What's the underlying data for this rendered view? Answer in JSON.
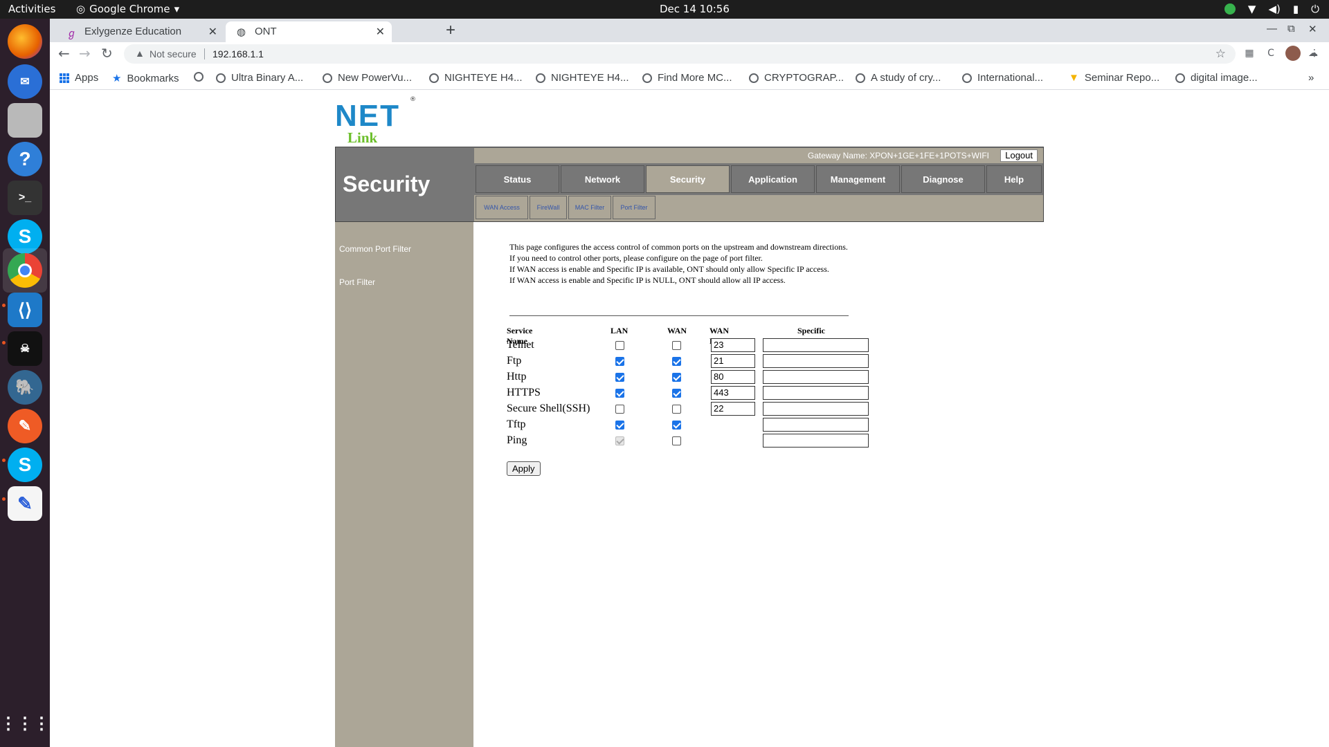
{
  "system_bar": {
    "activities": "Activities",
    "app_name": "Google Chrome",
    "clock": "Dec 14  10:56"
  },
  "browser": {
    "tabs": [
      {
        "title": "Exlygenze Education",
        "active": false
      },
      {
        "title": "ONT",
        "active": true
      }
    ],
    "omnibox": {
      "security": "Not secure",
      "url": "192.168.1.1"
    },
    "bookmarks": [
      "Apps",
      "Bookmarks",
      "Ultra Binary A...",
      "New PowerVu...",
      "NIGHTEYE H4...",
      "NIGHTEYE H4...",
      "Find More MC...",
      "CRYPTOGRAP...",
      "A study of cry...",
      "International...",
      "Seminar Repo...",
      "digital image..."
    ]
  },
  "ont": {
    "logo": {
      "top": "NET",
      "bottom": "Link"
    },
    "page_title": "Security",
    "gateway_name": "Gateway Name: XPON+1GE+1FE+1POTS+WIFI",
    "logout_label": "Logout",
    "menu": [
      "Status",
      "Network",
      "Security",
      "Application",
      "Management",
      "Diagnose",
      "Help"
    ],
    "active_menu": "Security",
    "submenu": [
      "WAN Access",
      "FireWall",
      "MAC Filter",
      "Port Filter"
    ],
    "left_nav": [
      "Common Port Filter",
      "Port Filter"
    ],
    "description": [
      "This page configures the access control of common ports on the upstream and downstream directions.",
      "If you need to control other ports, please configure on the page of port filter.",
      "If WAN access is enable and Specific IP is available, ONT should only allow Specific IP access.",
      "If WAN access is enable and Specific IP is NULL, ONT should allow all IP access."
    ],
    "table": {
      "headers": [
        "Service Name",
        "LAN",
        "WAN",
        "WAN PORT",
        "Specific IP"
      ],
      "rows": [
        {
          "service": "Telnet",
          "lan": false,
          "wan": false,
          "port": "23",
          "ip": ""
        },
        {
          "service": "Ftp",
          "lan": true,
          "wan": true,
          "port": "21",
          "ip": ""
        },
        {
          "service": "Http",
          "lan": true,
          "wan": true,
          "port": "80",
          "ip": ""
        },
        {
          "service": "HTTPS",
          "lan": true,
          "wan": true,
          "port": "443",
          "ip": ""
        },
        {
          "service": "Secure Shell(SSH)",
          "lan": false,
          "wan": false,
          "port": "22",
          "ip": ""
        },
        {
          "service": "Tftp",
          "lan": true,
          "wan": true,
          "port": "",
          "ip": ""
        },
        {
          "service": "Ping",
          "lan": "disabled-checked",
          "wan": false,
          "port": "",
          "ip": ""
        }
      ]
    },
    "apply_label": "Apply"
  },
  "colors": {
    "accent": "#1a73e8",
    "header_gray": "#777777",
    "tan": "#aca697"
  }
}
